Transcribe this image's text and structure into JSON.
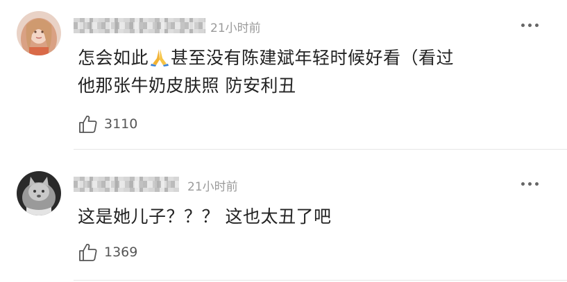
{
  "comments": [
    {
      "time": "21小时前",
      "text_line1_before": "怎会如此",
      "text_line1_after": "甚至没有陈建斌年轻时候好看（看过",
      "text_line2": "他那张牛奶皮肤照 防安利丑",
      "likes": "3110",
      "icons": {
        "like": "thumbs-up-icon",
        "more": "more-dots-icon",
        "emoji": "praying-hands-emoji"
      }
    },
    {
      "time": "21小时前",
      "text_line1": "这是她儿子？？？ 这也太丑了吧",
      "likes": "1369",
      "icons": {
        "like": "thumbs-up-icon",
        "more": "more-dots-icon"
      }
    }
  ]
}
